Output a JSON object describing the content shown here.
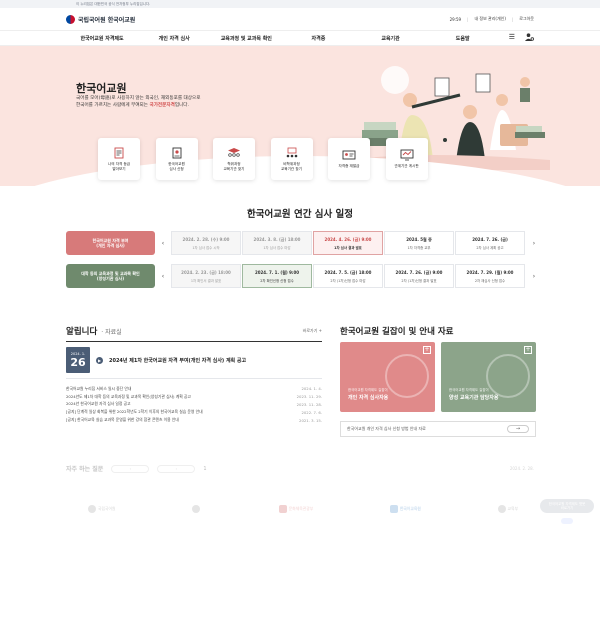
{
  "gov_notice": "이 누리집은 대한민국 공식 전자정부 누리집입니다.",
  "header": {
    "logo_text": "국립국어원 한국어교원",
    "time": "29:59",
    "extend": "내 정보 관리(개인)",
    "logout": "로그아웃"
  },
  "nav": {
    "items": [
      "한국어교원 자격제도",
      "개인 자격 심사",
      "교육과정 및 교과목 확인",
      "자격증",
      "교육기관",
      "도움말"
    ],
    "menu_icon": "hamburger-icon",
    "user_icon": "user-settings-icon"
  },
  "hero": {
    "title": "한국어교원",
    "desc_line1": "국어를 모어(母語)로 사용하지 않는 외국인, 재외동포를 대상으로",
    "desc_line2_pre": "한국어를 가르치는 사람에게 부여되는 ",
    "desc_line2_hl": "국가전문자격",
    "desc_line2_post": "입니다."
  },
  "quick_links": [
    {
      "label": "나의 자격 등급\n알아보기",
      "icon": "document-search-icon"
    },
    {
      "label": "한국어교원\n심사 신청",
      "icon": "application-form-icon"
    },
    {
      "label": "학위과정\n교육기관 찾기",
      "icon": "graduation-group-icon"
    },
    {
      "label": "비학위과정\n교육기관 찾기",
      "icon": "classroom-group-icon"
    },
    {
      "label": "자격증 재발급",
      "icon": "id-card-icon"
    },
    {
      "label": "관계기관 게시판",
      "icon": "monitor-board-icon"
    }
  ],
  "schedule": {
    "title": "한국어교원 연간 심사 일정",
    "rows": [
      {
        "label": "한국어교원 자격 부여\n(개인 자격 심사)",
        "color": "#d77a7a",
        "slots": [
          {
            "date": "2024. 2. 28. (수) 9:00",
            "text": "1차 심사 접수 시작",
            "state": "past"
          },
          {
            "date": "2024. 3. 8. (금) 18:00",
            "text": "1차 심사 접수 마감",
            "state": "past"
          },
          {
            "date": "2024. 4. 26. (금) 9:00",
            "text": "1차 심사 결과 발표",
            "state": "active-red"
          },
          {
            "date": "2024. 5월 중",
            "text": "1차 자격증 교부",
            "state": "future"
          },
          {
            "date": "2024. 7. 26. (금)",
            "text": "2차 심사 계획 공고",
            "state": "future"
          }
        ]
      },
      {
        "label": "대학 등의 교육과정 및 교과목 확인\n(양성기관 심사)",
        "color": "#6f8a6d",
        "slots": [
          {
            "date": "2024. 2. 23. (금) 18:00",
            "text": "1차 확인서 결과 발표",
            "state": "past"
          },
          {
            "date": "2024. 7. 1. (월) 9:00",
            "text": "2차 확인신청 신청 접수",
            "state": "active-green"
          },
          {
            "date": "2024. 7. 5. (금) 18:00",
            "text": "2차 (1차)신청 접수 마감",
            "state": "future"
          },
          {
            "date": "2024. 7. 26. (금) 9:00",
            "text": "2차 (1차)신청 결과 발표",
            "state": "future"
          },
          {
            "date": "2024. 7. 29. (월) 9:00",
            "text": "2차 재심사 신청 접수",
            "state": "future"
          }
        ]
      }
    ]
  },
  "notice": {
    "title": "알립니다",
    "sub": "· 자료실",
    "more": "바로가기 +",
    "feature": {
      "ym": "2024. 1.",
      "day": "26",
      "title": "2024년 제1차 한국어교원 자격 부여(개인 자격 심사) 계획 공고"
    },
    "items": [
      {
        "title": "한국어교원 누리집 서비스 일시 중단 안내",
        "date": "2024. 1. 4."
      },
      {
        "title": "2024년도 제1차 대학 등의 교육과정 및 교과목 확인(양성기관 심사) 계획 공고",
        "date": "2023. 11. 29."
      },
      {
        "title": "2024년 한국어교원 자격 심사 일정 공고",
        "date": "2023. 11. 28."
      },
      {
        "title": "[공지] 단계적 일상 회복을 위한 2022학년도 2학기 이후의 한국어교육 실습 운영 안내",
        "date": "2022. 7. 6."
      },
      {
        "title": "[공지] 한국어교육 실습 교과목 운영을 위한 강의 참관 콘텐츠 이용 안내",
        "date": "2021. 3. 15."
      }
    ]
  },
  "guide": {
    "title": "한국어교원 길잡이 및 안내 자료",
    "cards": [
      {
        "cap": "한국어교원 자격제도 길잡이",
        "name": "개인 자격 심사자용",
        "color": "#e08a8a"
      },
      {
        "cap": "한국어교원 자격제도 길잡이",
        "name": "양성 교육기관 담당자용",
        "color": "#8ca48a"
      }
    ],
    "field": "한국어교원 개인 자격 심사 신청 방법 안내 자료",
    "field_arrow": "→"
  },
  "faq": {
    "title": "자주 하는 질문",
    "pill1": "",
    "pill2": "",
    "page": "1",
    "date": "2024. 2. 28."
  },
  "partners": [
    "국립국어원",
    "",
    "문화체육관광부",
    "한국어교육원",
    "교육부"
  ],
  "float_btn": "한국어교원 자격제도 챗봇\n바로가기"
}
